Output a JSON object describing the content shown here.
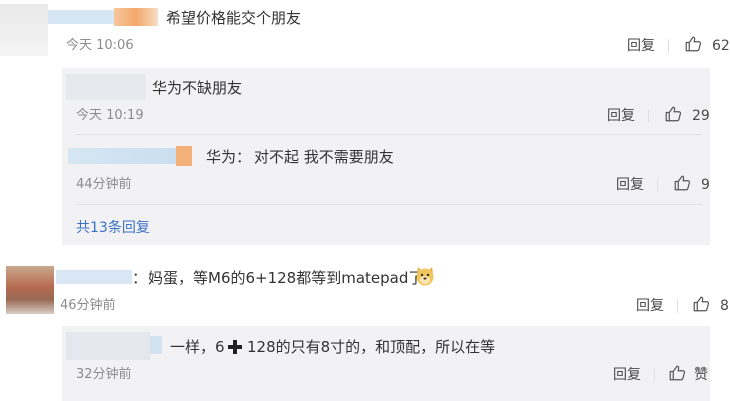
{
  "comments": [
    {
      "text": "希望价格能交个朋友",
      "time": "今天 10:06",
      "reply_label": "回复",
      "likes": "62",
      "replies": [
        {
          "text": "华为不缺朋友",
          "time": "今天 10:19",
          "reply_label": "回复",
          "likes": "29"
        },
        {
          "prefix": "华为：",
          "text": "对不起 我不需要朋友",
          "time": "44分钟前",
          "reply_label": "回复",
          "likes": "9"
        }
      ],
      "more_replies": "共13条回复"
    },
    {
      "prefix": "：",
      "text": "妈蛋，等M6的6+128都等到matepad了",
      "emoji": "doge-emoji",
      "time": "46分钟前",
      "reply_label": "回复",
      "likes": "8",
      "replies": [
        {
          "text_a": "一样，6",
          "text_b": "128的只有8寸的，和顶配，所以在等",
          "time": "32分钟前",
          "reply_label": "回复",
          "likes": "赞"
        }
      ]
    }
  ],
  "colors": {
    "link": "#3b71c4",
    "panel_bg": "#f2f2f5",
    "meta_text": "#8c8c8c"
  },
  "icons": [
    "thumbs-up-icon",
    "plus-icon",
    "doge-emoji"
  ]
}
